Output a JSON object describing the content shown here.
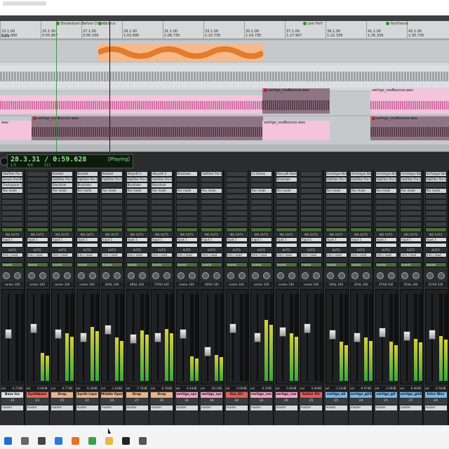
{
  "ruler": {
    "bars": [
      {
        "bar": "23.1.00",
        "time": "0:55.000"
      },
      {
        "bar": "25.1.00",
        "time": "0:55.867"
      },
      {
        "bar": "27.1.00",
        "time": "0:56.339"
      },
      {
        "bar": "29.1.00",
        "time": "1:02.895"
      },
      {
        "bar": "31.1.00",
        "time": "1:06.735"
      },
      {
        "bar": "33.1.00",
        "time": "1:10.735"
      },
      {
        "bar": "35.1.00",
        "time": "1:14.735"
      },
      {
        "bar": "37.1.00",
        "time": "1:17.907"
      },
      {
        "bar": "39.1.00",
        "time": "1:22.339"
      },
      {
        "bar": "41.1.00",
        "time": "1:26.339"
      },
      {
        "bar": "43.1.00",
        "time": "1:30.735"
      }
    ],
    "markers": [
      "Breakdown Before Chorus",
      "Chorus",
      "Jam Part",
      "Northerse"
    ],
    "rate_label": "Rate"
  },
  "clips": {
    "clip_a": "vertigo_vsxBounce.wav",
    "clip_b": "vertigo_vsxBounce.wav",
    "clip_c": "vertigo_vsxBounce.wav",
    "clip_d": "vertigo_vsxBounce.wav",
    "clip_e": "vertigo_vsxBounce.wav"
  },
  "transport": {
    "counter": "28.3.31 / 0:59.628",
    "state": "[Playing]",
    "sub_bar": "1.5",
    "sub_meter": "4/4",
    "sub_bpm": "111"
  },
  "mixer": {
    "section_labels": {
      "io": "INS OUTS",
      "input": "Input 1",
      "auto": "AUTO",
      "mode": "trim / read",
      "inserts": "inserts"
    },
    "strips": [
      {
        "inserts": [
          "FabFilter Pro-C",
          "Smack And Bl",
          "Trackspacer 2"
        ],
        "rec": "Rec mode",
        "pan": "center",
        "vol": "-4.72dB",
        "name": "Bass Ins",
        "name_color": "#e0e0e0",
        "num": "33",
        "out": "master",
        "fader": 0.55,
        "meter": 0.0
      },
      {
        "inserts": [
          "",
          "",
          ""
        ],
        "rec": "",
        "pan": "center",
        "vol": "0.00dB",
        "name": "Synthbass",
        "name_color": "#e36a5a",
        "num": "23",
        "out": "master",
        "fader": 0.62,
        "meter": 0.32
      },
      {
        "inserts": [
          "Kontakt",
          "FabFilter Pro-C",
          "Blackhole"
        ],
        "rec": "Rec mode",
        "pan": "center",
        "vol": "-4.77dB",
        "name": "Drop",
        "name_color": "#e9b38a",
        "num": "25",
        "out": "master",
        "fader": 0.55,
        "meter": 0.55
      },
      {
        "inserts": [
          "Kontakt",
          "FabFilter Pro-C",
          "Blackhole"
        ],
        "rec": "Rec mode",
        "pan": "center",
        "vol": "-6.39dB",
        "name": "Synth Laye",
        "name_color": "#e9b38a",
        "num": "22",
        "out": "master",
        "fader": 0.5,
        "meter": 0.62
      },
      {
        "inserts": [
          "Kontakt",
          "FabFilter Pro-C",
          ""
        ],
        "rec": "Rec mode",
        "pan": "20%L",
        "vol": "-1.43dB",
        "name": "Middle Oper",
        "name_color": "#e9b38a",
        "num": "24",
        "out": "master",
        "fader": 0.6,
        "meter": 0.5
      },
      {
        "inserts": [
          "Absynth 5",
          "FabFilter Pro-C",
          "Blackhole"
        ],
        "rec": "Rec mode",
        "pan": "48%L",
        "vol": "-7.76dB",
        "name": "Drop",
        "name_color": "#e9b38a",
        "num": "27",
        "out": "master",
        "fader": 0.48,
        "meter": 0.58
      },
      {
        "inserts": [
          "Absynth 5",
          "FabFilter Pro-C",
          "Blackhole"
        ],
        "rec": "Rec mode",
        "pan": "57%R",
        "vol": "-6.78dB",
        "name": "Drop",
        "name_color": "#e9b38a",
        "num": "31",
        "out": "master",
        "fader": 0.5,
        "meter": 0.6
      },
      {
        "inserts": [
          "Blackhole",
          "",
          ""
        ],
        "rec": "Rec mode",
        "pan": "center",
        "vol": "-4.44dB",
        "name": "vertigo_sys",
        "name_color": "#f2a6c8",
        "num": "32",
        "out": "master",
        "fader": 0.55,
        "meter": 0.28
      },
      {
        "inserts": [
          "FabFilter Pro-C",
          "",
          ""
        ],
        "rec": "Rec mode",
        "pan": "34%R",
        "vol": "-16.1dB",
        "name": "vertigo_sys",
        "name_color": "#f2a6c8",
        "num": "18",
        "out": "master",
        "fader": 0.32,
        "meter": 0.3
      },
      {
        "inserts": [
          "",
          "",
          ""
        ],
        "rec": "",
        "pan": "center",
        "vol": "0.00dB",
        "name": "Vox_Str",
        "name_color": "#e0605a",
        "num": "34",
        "out": "master",
        "fader": 0.62,
        "meter": 0.0
      },
      {
        "inserts": [
          "L2 Stereo",
          "",
          ""
        ],
        "rec": "Rec mode",
        "pan": "center",
        "vol": "-6.1fdB",
        "name": "vertigo_vox",
        "name_color": "#f2a6c8",
        "num": "33",
        "out": "master",
        "fader": 0.5,
        "meter": 0.7
      },
      {
        "inserts": [
          "MannyM Distor",
          "Blackhole",
          ""
        ],
        "rec": "Rec mode",
        "pan": "center",
        "vol": "-3.96dB",
        "name": "vertigo_vox",
        "name_color": "#f2a6c8",
        "num": "26",
        "out": "master",
        "fader": 0.57,
        "meter": 0.55
      },
      {
        "inserts": [
          "",
          "",
          ""
        ],
        "rec": "",
        "pan": "center",
        "vol": "0.00dB",
        "name": "Guitar Str",
        "name_color": "#e0605a",
        "num": "35",
        "out": "master",
        "fader": 0.62,
        "meter": 0.0
      },
      {
        "inserts": [
          "Archetype Nolt",
          "FabFilter Pro-C",
          ""
        ],
        "rec": "Rec mode",
        "pan": "30%L",
        "vol": "-5.43dB",
        "name": "vertigo_ali",
        "name_color": "#7ab8e8",
        "num": "25",
        "out": "master",
        "fader": 0.54,
        "meter": 0.45
      },
      {
        "inserts": [
          "Archetype Nolt",
          "FabFilter Pro-C",
          ""
        ],
        "rec": "Rec mode",
        "pan": "32%L",
        "vol": "-6.97dB",
        "name": "vertigo_git2",
        "name_color": "#7ab8e8",
        "num": "24",
        "out": "master",
        "fader": 0.5,
        "meter": 0.5
      },
      {
        "inserts": [
          "Archetype Nolt",
          "FabFilter Pro-C",
          ""
        ],
        "rec": "Rec mode",
        "pan": "47%R",
        "vol": "-3.39dB",
        "name": "vertigo_git",
        "name_color": "#7ab8e8",
        "num": "25",
        "out": "master",
        "fader": 0.56,
        "meter": 0.45
      },
      {
        "inserts": [
          "Archetype Nolt",
          "FabFilter Pro-C",
          ""
        ],
        "rec": "Rec mode",
        "pan": "52%L",
        "vol": "-6.46dB",
        "name": "vertigo_git4",
        "name_color": "#7ab8e8",
        "num": "27",
        "out": "master",
        "fader": 0.52,
        "meter": 0.48
      },
      {
        "inserts": [
          "Archetype Nolt",
          "FabFilter Pro-C",
          ""
        ],
        "rec": "Rec mode",
        "pan": "51%R",
        "vol": "-4.56dB",
        "name": "Intro Wav",
        "name_color": "#7ab8e8",
        "num": "24",
        "out": "master",
        "fader": 0.54,
        "meter": 0.52
      }
    ]
  },
  "taskbar": {
    "icons": [
      "windows-icon",
      "search-icon",
      "task-view-icon",
      "edge-icon",
      "firefox-icon",
      "chrome-icon",
      "folder-icon",
      "protools-icon",
      "clock-icon"
    ]
  }
}
